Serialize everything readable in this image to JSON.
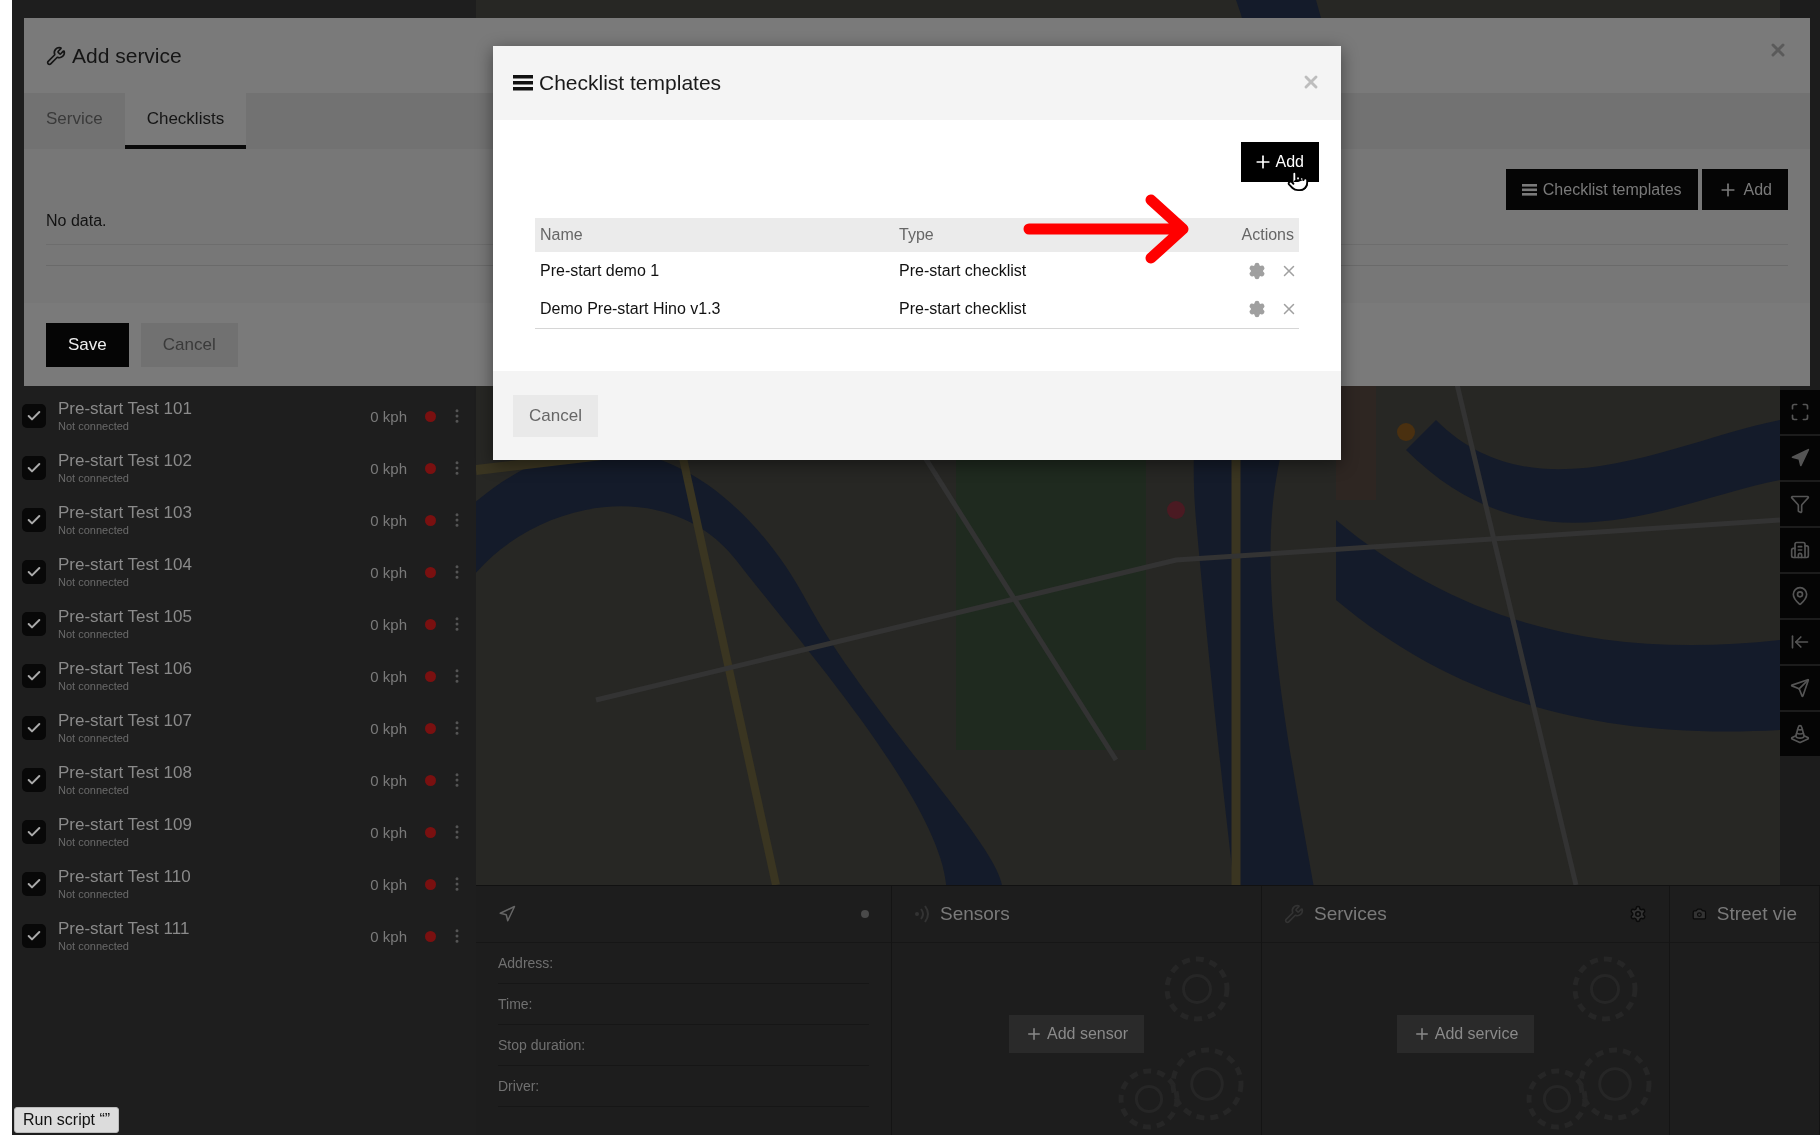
{
  "add_service_dialog": {
    "title": "Add service",
    "tabs": [
      {
        "label": "Service",
        "selected": false
      },
      {
        "label": "Checklists",
        "selected": true
      }
    ],
    "toolbar_buttons": [
      {
        "label": "Checklist templates",
        "kind": "templates"
      },
      {
        "label": "Add",
        "kind": "add"
      }
    ],
    "empty_text": "No data.",
    "buttons": [
      {
        "label": "Save",
        "kind": "primary"
      },
      {
        "label": "Cancel",
        "kind": "secondary"
      }
    ]
  },
  "checklist_templates_modal": {
    "title": "Checklist templates",
    "add_button": "Add",
    "table": {
      "columns": [
        "Name",
        "Type",
        "Actions"
      ],
      "rows": [
        {
          "name": "Pre-start demo 1",
          "type": "Pre-start checklist"
        },
        {
          "name": "Demo Pre-start Hino v1.3",
          "type": "Pre-start checklist"
        }
      ]
    },
    "cancel_button": "Cancel"
  },
  "vehicles": [
    {
      "name": "Pre-start Test 101",
      "status": "Not connected",
      "speed": "0 kph",
      "checked": true
    },
    {
      "name": "Pre-start Test 102",
      "status": "Not connected",
      "speed": "0 kph",
      "checked": true
    },
    {
      "name": "Pre-start Test 103",
      "status": "Not connected",
      "speed": "0 kph",
      "checked": true
    },
    {
      "name": "Pre-start Test 104",
      "status": "Not connected",
      "speed": "0 kph",
      "checked": true
    },
    {
      "name": "Pre-start Test 105",
      "status": "Not connected",
      "speed": "0 kph",
      "checked": true
    },
    {
      "name": "Pre-start Test 106",
      "status": "Not connected",
      "speed": "0 kph",
      "checked": true
    },
    {
      "name": "Pre-start Test 107",
      "status": "Not connected",
      "speed": "0 kph",
      "checked": true
    },
    {
      "name": "Pre-start Test 108",
      "status": "Not connected",
      "speed": "0 kph",
      "checked": true
    },
    {
      "name": "Pre-start Test 109",
      "status": "Not connected",
      "speed": "0 kph",
      "checked": true
    },
    {
      "name": "Pre-start Test 110",
      "status": "Not connected",
      "speed": "0 kph",
      "checked": true
    },
    {
      "name": "Pre-start Test 111",
      "status": "Not connected",
      "speed": "0 kph",
      "checked": true
    }
  ],
  "run_script_button": "Run script “”",
  "location_panel": {
    "fields": [
      "Address:",
      "Time:",
      "Stop duration:",
      "Driver:"
    ]
  },
  "panels": [
    {
      "kind": "sensors",
      "title": "Sensors",
      "button": "Add sensor"
    },
    {
      "kind": "services",
      "title": "Services",
      "button": "Add service"
    },
    {
      "kind": "street_view",
      "title": "Street vie"
    }
  ]
}
